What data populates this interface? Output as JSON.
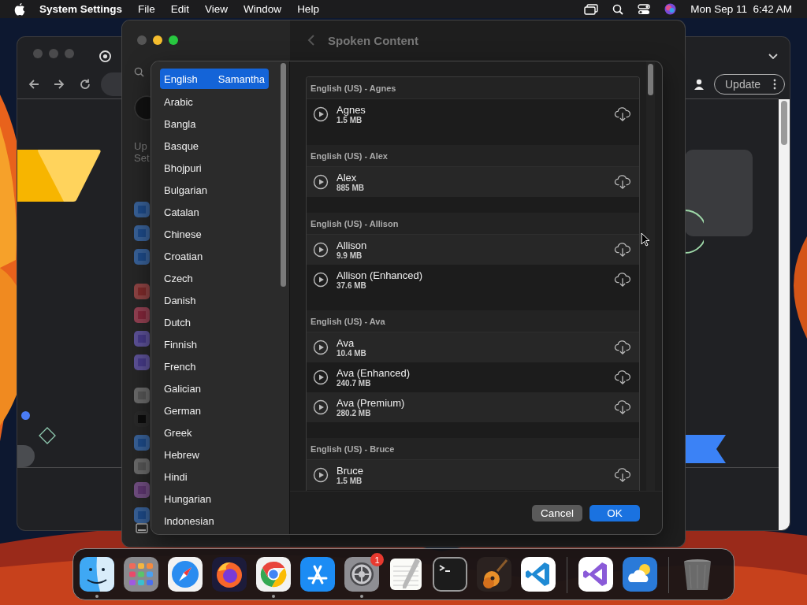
{
  "menu_bar": {
    "app": "System Settings",
    "menus": [
      "File",
      "Edit",
      "View",
      "Window",
      "Help"
    ],
    "clock": "Mon Sep 11  6:42 AM"
  },
  "browser": {
    "update_button": "Update"
  },
  "settings": {
    "title": "Spoken Content",
    "sidebar_fragments": [
      "Up",
      "Set"
    ]
  },
  "sheet": {
    "languages": [
      {
        "name": "English",
        "voice": "Samantha",
        "selected": true
      },
      {
        "name": "Arabic",
        "selected": false
      },
      {
        "name": "Bangla",
        "selected": false
      },
      {
        "name": "Basque",
        "selected": false
      },
      {
        "name": "Bhojpuri",
        "selected": false
      },
      {
        "name": "Bulgarian",
        "selected": false
      },
      {
        "name": "Catalan",
        "selected": false
      },
      {
        "name": "Chinese",
        "selected": false
      },
      {
        "name": "Croatian",
        "selected": false
      },
      {
        "name": "Czech",
        "selected": false
      },
      {
        "name": "Danish",
        "selected": false
      },
      {
        "name": "Dutch",
        "selected": false
      },
      {
        "name": "Finnish",
        "selected": false
      },
      {
        "name": "French",
        "selected": false
      },
      {
        "name": "Galician",
        "selected": false
      },
      {
        "name": "German",
        "selected": false
      },
      {
        "name": "Greek",
        "selected": false
      },
      {
        "name": "Hebrew",
        "selected": false
      },
      {
        "name": "Hindi",
        "selected": false
      },
      {
        "name": "Hungarian",
        "selected": false
      },
      {
        "name": "Indonesian",
        "selected": false
      }
    ],
    "voice_groups": [
      {
        "header": "English (US) - Agnes",
        "voices": [
          {
            "name": "Agnes",
            "size": "1.5 MB"
          }
        ]
      },
      {
        "header": "English (US) - Alex",
        "voices": [
          {
            "name": "Alex",
            "size": "885 MB"
          }
        ]
      },
      {
        "header": "English (US) - Allison",
        "voices": [
          {
            "name": "Allison",
            "size": "9.9 MB"
          },
          {
            "name": "Allison (Enhanced)",
            "size": "37.6 MB"
          }
        ]
      },
      {
        "header": "English (US) - Ava",
        "voices": [
          {
            "name": "Ava",
            "size": "10.4 MB"
          },
          {
            "name": "Ava (Enhanced)",
            "size": "240.7 MB"
          },
          {
            "name": "Ava (Premium)",
            "size": "280.2 MB"
          }
        ]
      },
      {
        "header": "English (US) - Bruce",
        "voices": [
          {
            "name": "Bruce",
            "size": "1.5 MB"
          }
        ]
      }
    ],
    "buttons": [
      {
        "label": "Cancel",
        "kind": "secondary"
      },
      {
        "label": "OK",
        "kind": "primary"
      }
    ]
  },
  "dock": {
    "items": [
      {
        "kind": "finder",
        "running": true
      },
      {
        "kind": "launchpad",
        "running": false
      },
      {
        "kind": "safari",
        "running": false
      },
      {
        "kind": "firefox",
        "running": false
      },
      {
        "kind": "chrome",
        "running": true
      },
      {
        "kind": "appstore",
        "running": false
      },
      {
        "kind": "settings",
        "running": true,
        "badge": "1"
      },
      {
        "kind": "textedit",
        "running": false
      },
      {
        "kind": "terminal",
        "running": false
      },
      {
        "kind": "garageband",
        "running": false
      },
      {
        "kind": "vscode",
        "running": false
      },
      {
        "kind": "separator"
      },
      {
        "kind": "visualstudio",
        "running": false
      },
      {
        "kind": "weather",
        "running": false
      },
      {
        "kind": "separator"
      },
      {
        "kind": "trash",
        "running": false
      }
    ]
  }
}
